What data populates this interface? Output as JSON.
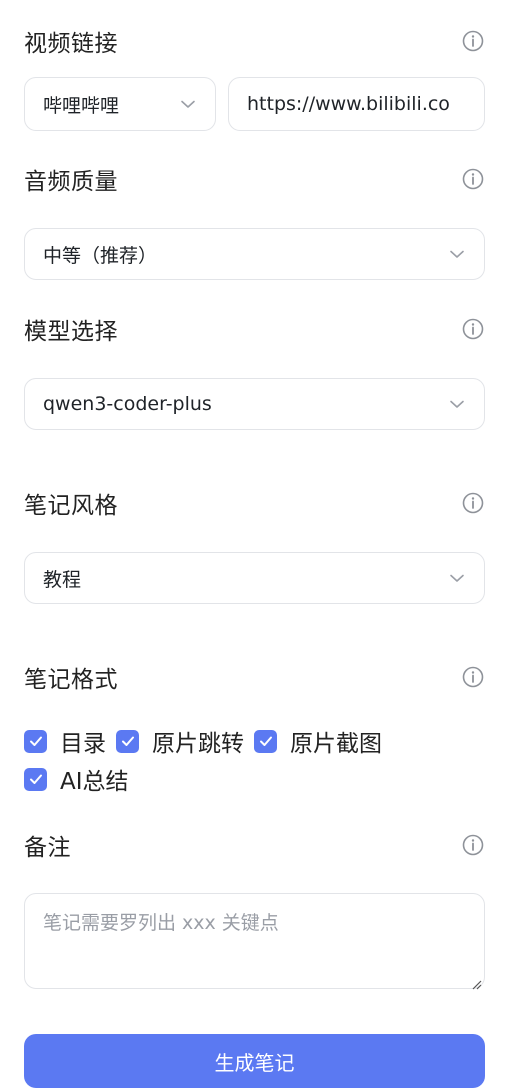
{
  "video_link": {
    "label": "视频链接",
    "platform": "哔哩哔哩",
    "url": "https://www.bilibili.co"
  },
  "audio_quality": {
    "label": "音频质量",
    "value": "中等（推荐）"
  },
  "model": {
    "label": "模型选择",
    "value": "qwen3-coder-plus"
  },
  "note_style": {
    "label": "笔记风格",
    "value": "教程"
  },
  "note_format": {
    "label": "笔记格式",
    "options": [
      {
        "label": "目录",
        "checked": true
      },
      {
        "label": "原片跳转",
        "checked": true
      },
      {
        "label": "原片截图",
        "checked": true
      },
      {
        "label": "AI总结",
        "checked": true
      }
    ]
  },
  "remarks": {
    "label": "备注",
    "placeholder": "笔记需要罗列出 xxx 关键点"
  },
  "submit": {
    "label": "生成笔记"
  },
  "colors": {
    "accent": "#5b79f2",
    "border": "#e2e4e8",
    "icon_gray": "#8e9299"
  },
  "icons": {
    "info": "info-icon",
    "chevron": "chevron-down-icon",
    "check": "check-icon"
  }
}
